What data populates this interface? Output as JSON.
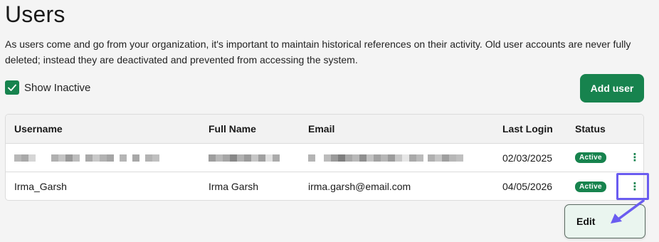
{
  "page": {
    "title": "Users",
    "description": "As users come and go from your organization, it's important to maintain historical references on their activity. Old user accounts are never fully deleted; instead they are deactivated and prevented from accessing the system."
  },
  "filters": {
    "show_inactive_label": "Show Inactive",
    "show_inactive_checked": true
  },
  "toolbar": {
    "add_user_label": "Add user"
  },
  "table": {
    "columns": [
      "Username",
      "Full Name",
      "Email",
      "Last Login",
      "Status"
    ],
    "rows": [
      {
        "username": "",
        "full_name": "",
        "email": "",
        "last_login": "02/03/2025",
        "status": "Active",
        "redacted": true
      },
      {
        "username": "Irma_Garsh",
        "full_name": "Irma Garsh",
        "email": "irma.garsh@email.com",
        "last_login": "04/05/2026",
        "status": "Active",
        "redacted": false
      }
    ],
    "row_action_icon": "kebab-menu-icon"
  },
  "row_menu": {
    "edit_label": "Edit"
  },
  "colors": {
    "accent": "#17834e",
    "highlight": "#6a5cf0",
    "menu_bg": "#eaf5ef"
  }
}
